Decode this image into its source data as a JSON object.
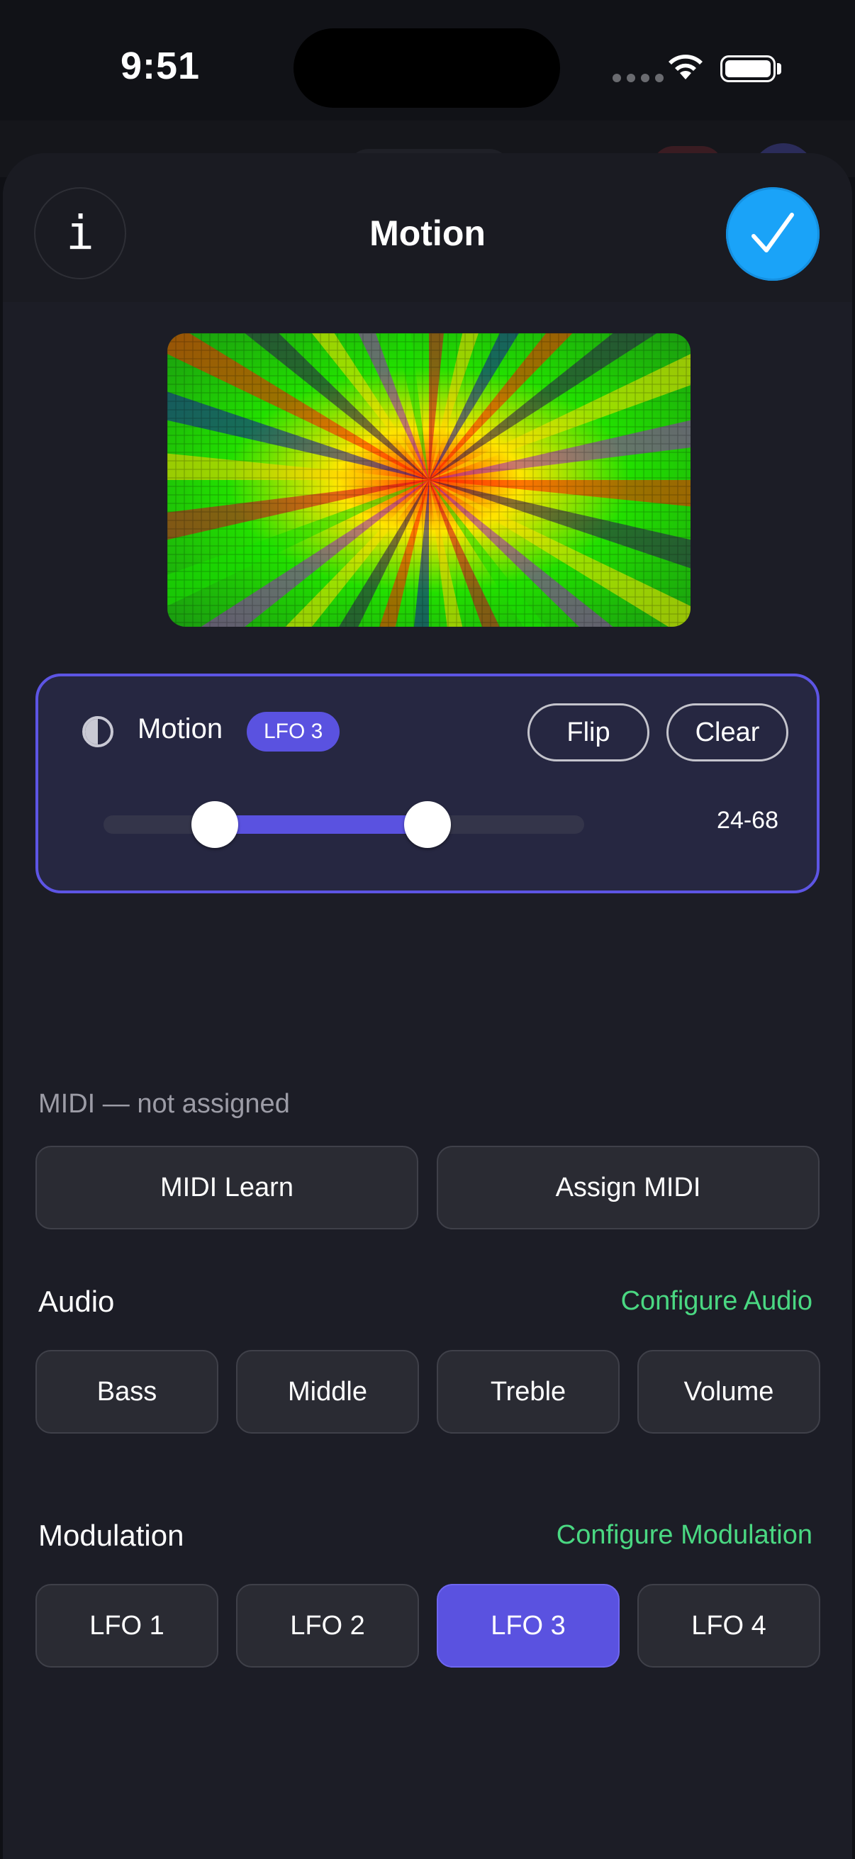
{
  "status_bar": {
    "time": "9:51"
  },
  "header": {
    "title": "Motion",
    "info_glyph": "i"
  },
  "motion": {
    "label": "Motion",
    "badge": "LFO 3",
    "flip_label": "Flip",
    "clear_label": "Clear",
    "range_text": "24-68",
    "range_low": 24,
    "range_high": 68
  },
  "midi": {
    "status": "MIDI — not assigned",
    "learn_label": "MIDI Learn",
    "assign_label": "Assign MIDI"
  },
  "audio": {
    "title": "Audio",
    "configure_label": "Configure Audio",
    "buttons": [
      "Bass",
      "Middle",
      "Treble",
      "Volume"
    ]
  },
  "modulation": {
    "title": "Modulation",
    "configure_label": "Configure Modulation",
    "buttons": [
      "LFO 1",
      "LFO 2",
      "LFO 3",
      "LFO 4"
    ],
    "selected": "LFO 3"
  },
  "colors": {
    "accent": "#5a52e0",
    "confirm": "#1aa3f8",
    "link": "#4ad882"
  },
  "icons": {
    "info": "info-icon",
    "confirm": "checkmark-icon",
    "motion": "contrast-half-circle-icon",
    "wifi": "wifi-icon",
    "battery": "battery-icon"
  }
}
